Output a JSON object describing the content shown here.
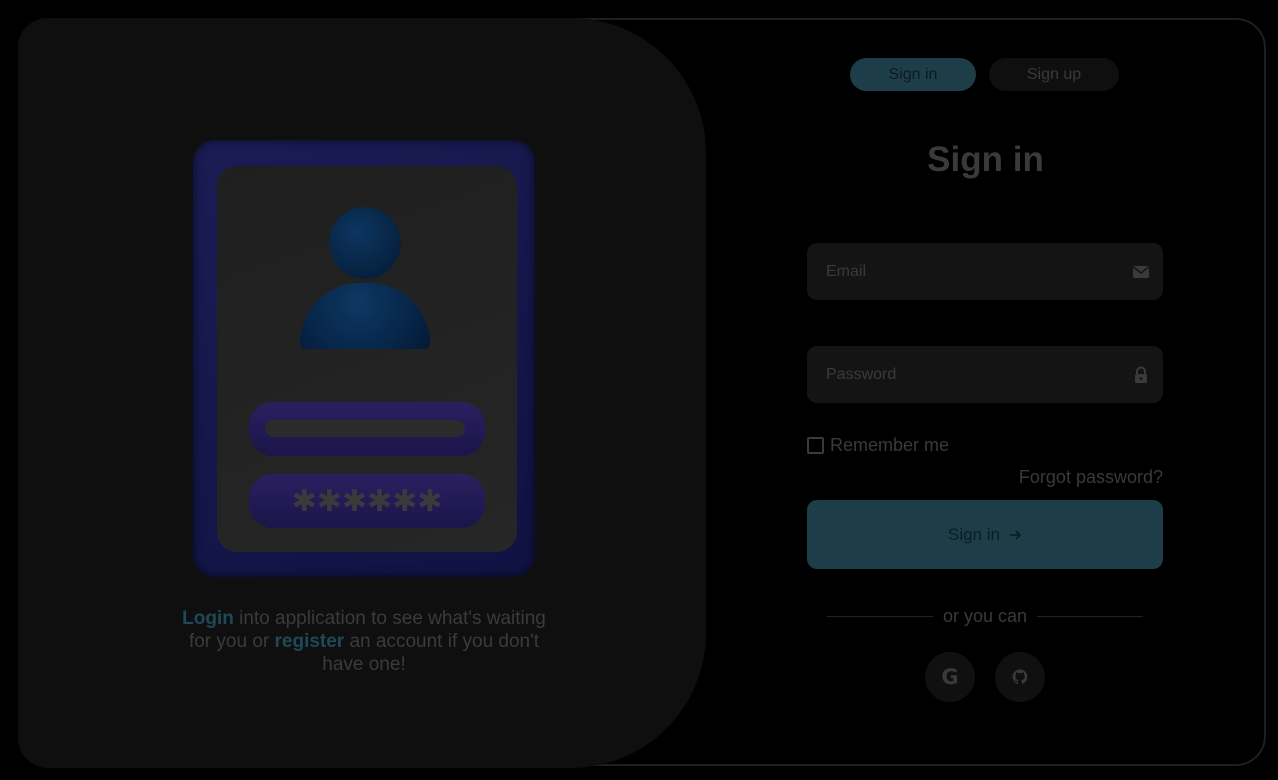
{
  "tabs": {
    "signin_label": "Sign in",
    "signup_label": "Sign up"
  },
  "form": {
    "title": "Sign in",
    "email_placeholder": "Email",
    "password_placeholder": "Password",
    "remember_label": "Remember me",
    "forgot_label": "Forgot password?",
    "submit_label": "Sign in",
    "submit_icon": "arrow-right-icon",
    "divider_label": "or you can"
  },
  "social": {
    "google_glyph": "G",
    "google_icon": "google-icon",
    "github_icon": "github-icon"
  },
  "illustration": {
    "password_mask": "✱✱✱✱✱✱",
    "caption": {
      "login_link": "Login",
      "text_1": " into application to see what's waiting for you or ",
      "register_link": "register",
      "text_2": " an account if you don't have one!"
    }
  },
  "colors": {
    "accent": "#1d3e48",
    "background": "#000000",
    "panel": "#0f0f0f",
    "text": "#3a3a3a"
  }
}
